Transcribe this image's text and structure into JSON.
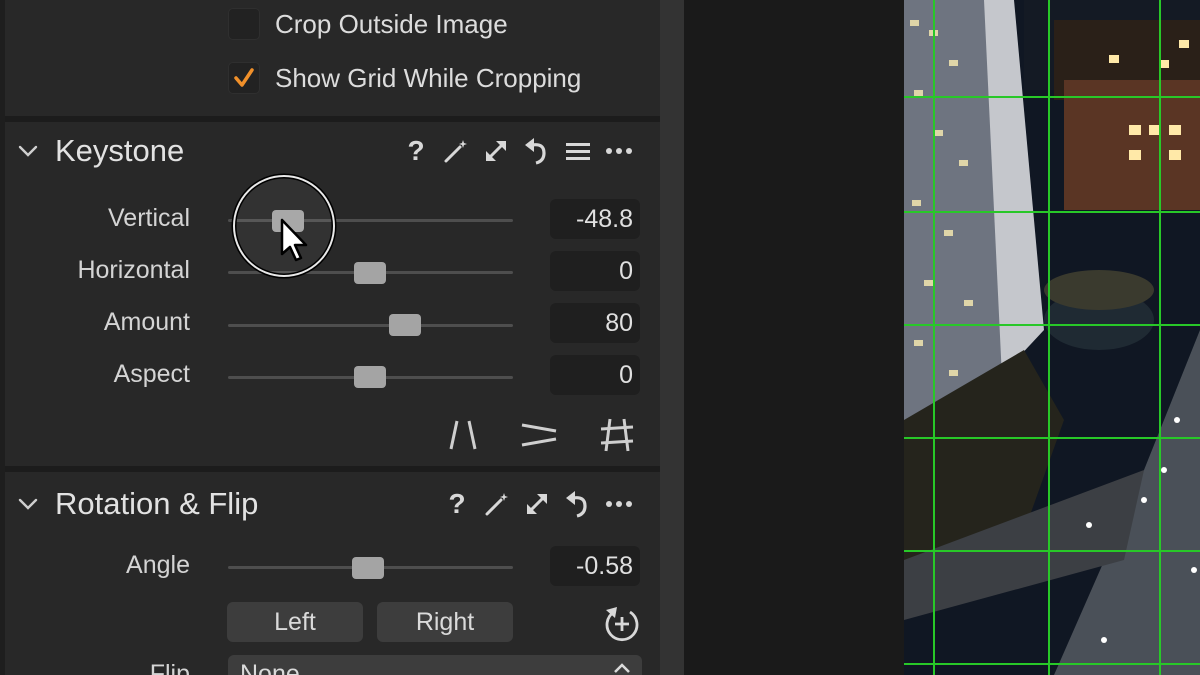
{
  "crop_options": {
    "crop_outside_label": "Crop Outside Image",
    "crop_outside_checked": false,
    "show_grid_label": "Show Grid While Cropping",
    "show_grid_checked": true
  },
  "keystone": {
    "title": "Keystone",
    "sliders": [
      {
        "label": "Vertical",
        "value": "-48.8",
        "position": 0.21
      },
      {
        "label": "Horizontal",
        "value": "0",
        "position": 0.5
      },
      {
        "label": "Amount",
        "value": "80",
        "position": 0.62
      },
      {
        "label": "Aspect",
        "value": "0",
        "position": 0.5
      }
    ],
    "header_icons": [
      "help-icon",
      "magic-wand-icon",
      "expand-icon",
      "reset-icon",
      "list-icon",
      "more-icon"
    ],
    "tools": [
      "vertical-keystone-icon",
      "horizontal-keystone-icon",
      "full-keystone-icon"
    ]
  },
  "rotation_flip": {
    "title": "Rotation & Flip",
    "angle_label": "Angle",
    "angle_value": "-0.58",
    "angle_position": 0.48,
    "left_label": "Left",
    "right_label": "Right",
    "flip_label": "Flip",
    "flip_value": "None",
    "header_icons": [
      "help-icon",
      "magic-wand-icon",
      "expand-icon",
      "reset-icon",
      "more-icon"
    ]
  },
  "colors": {
    "panel": "#282828",
    "checkmark": "#f0902a",
    "grid": "#28c828"
  }
}
